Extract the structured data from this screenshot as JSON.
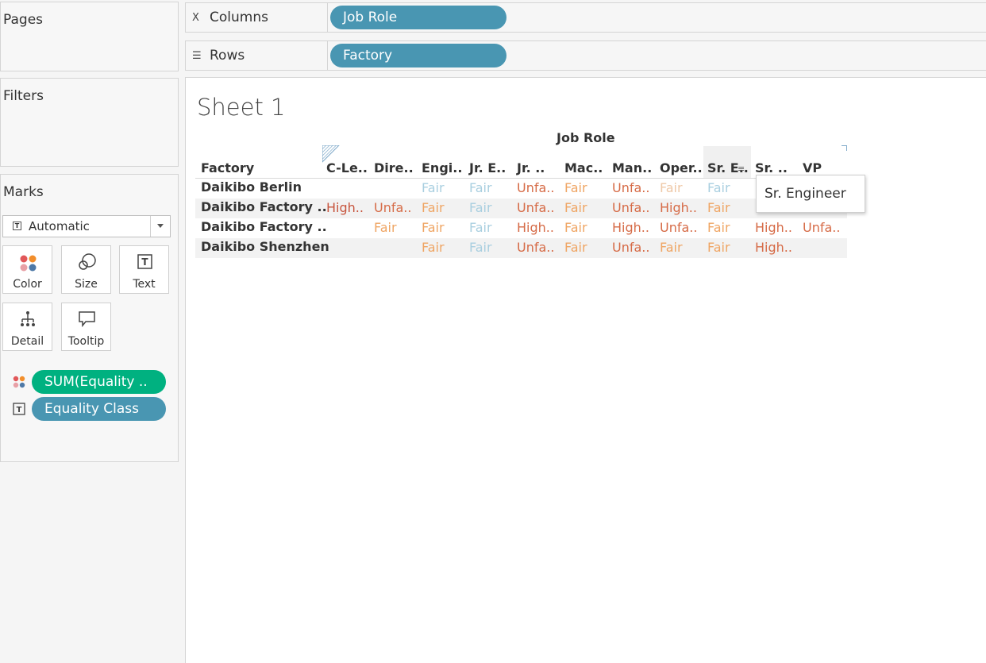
{
  "pages": {
    "title": "Pages"
  },
  "filters": {
    "title": "Filters"
  },
  "marks": {
    "title": "Marks",
    "mark_type": "Automatic",
    "buttons": {
      "color": "Color",
      "size": "Size",
      "text": "Text",
      "detail": "Detail",
      "tooltip": "Tooltip"
    },
    "fields": [
      {
        "label": "SUM(Equality ..",
        "type": "color",
        "pill_color": "#00b180"
      },
      {
        "label": "Equality Class",
        "type": "text",
        "pill_color": "#4996b2"
      }
    ]
  },
  "shelves": {
    "columns": {
      "label": "Columns",
      "icon": "columns-icon",
      "pill": "Job Role"
    },
    "rows": {
      "label": "Rows",
      "icon": "rows-icon",
      "pill": "Factory"
    }
  },
  "view": {
    "sheet_title": "Sheet 1",
    "column_axis_title": "Job Role",
    "row_header_title": "Factory",
    "columns": [
      "C-Le..",
      "Dire..",
      "Engi..",
      "Jr. E..",
      "Jr. ..",
      "Mac..",
      "Man..",
      "Oper..",
      "Sr. E..",
      "Sr. ..",
      "VP"
    ],
    "rows": [
      {
        "factory": "Daikibo Berlin",
        "cells": [
          "",
          "",
          "Fair",
          "Fair",
          "Unfa..",
          "Fair",
          "Unfa..",
          "Fair",
          "Fair",
          "",
          ""
        ]
      },
      {
        "factory": "Daikibo Factory ..",
        "cells": [
          "High..",
          "Unfa..",
          "Fair",
          "Fair",
          "Unfa..",
          "Fair",
          "Unfa..",
          "High..",
          "Fair",
          "",
          ""
        ]
      },
      {
        "factory": "Daikibo Factory ..",
        "cells": [
          "",
          "Fair",
          "Fair",
          "Fair",
          "High..",
          "Fair",
          "High..",
          "Unfa..",
          "Fair",
          "High..",
          "Unfa.."
        ]
      },
      {
        "factory": "Daikibo Shenzhen",
        "cells": [
          "",
          "",
          "Fair",
          "Fair",
          "Unfa..",
          "Fair",
          "Unfa..",
          "Fair",
          "Fair",
          "High..",
          ""
        ]
      }
    ],
    "cell_colors": [
      [
        "",
        "",
        "#a9cfe0",
        "#a9cfe0",
        "#d66b47",
        "#efa564",
        "#d66b47",
        "#efc9a8",
        "#a9cfe0",
        "",
        ""
      ],
      [
        "#c7553e",
        "#d66b47",
        "#efa564",
        "#a9cfe0",
        "#d66b47",
        "#efa564",
        "#d66b47",
        "#d66b47",
        "#efa564",
        "",
        ""
      ],
      [
        "",
        "#efa564",
        "#efa564",
        "#a9cfe0",
        "#d66b47",
        "#efa564",
        "#d66b47",
        "#d66b47",
        "#efa564",
        "#d66b47",
        "#d66b47"
      ],
      [
        "",
        "",
        "#efa564",
        "#a9cfe0",
        "#d66b47",
        "#efa564",
        "#d66b47",
        "#efa564",
        "#efa564",
        "#d66b47",
        ""
      ]
    ],
    "tooltip": "Sr. Engineer"
  }
}
